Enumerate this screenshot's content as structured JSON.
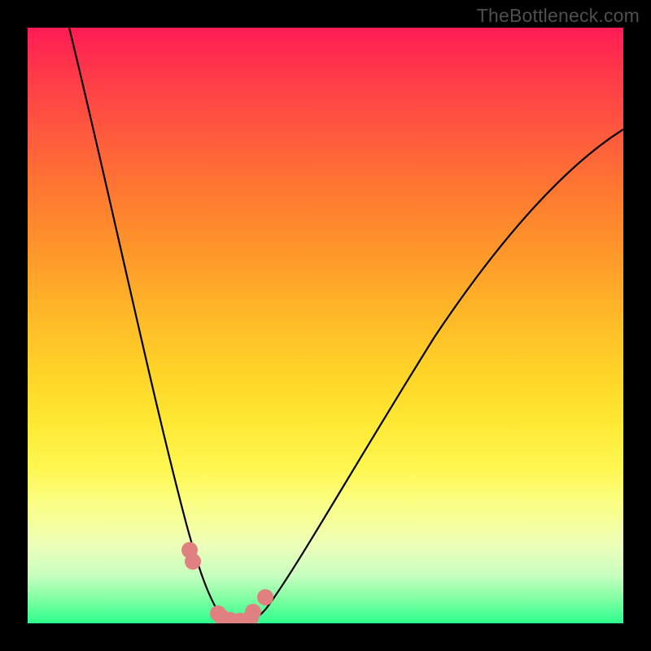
{
  "watermark": "TheBottleneck.com",
  "colors": {
    "background": "#000000",
    "curve": "#000000",
    "marker_fill": "#e18080",
    "marker_stroke": "#c96f6f"
  },
  "chart_data": {
    "type": "line",
    "title": "",
    "xlabel": "",
    "ylabel": "",
    "xlim": [
      0,
      100
    ],
    "ylim": [
      0,
      100
    ],
    "note": "Axis values estimated from pixel positions (no tick labels visible). y is inverted: 0 at bottom, 100 at top.",
    "series": [
      {
        "name": "left-curve",
        "x": [
          7,
          10,
          13,
          16,
          18,
          20,
          22,
          24,
          25.5,
          27,
          28.5,
          30,
          31.5,
          33
        ],
        "y": [
          100,
          86,
          72,
          58,
          48,
          40,
          32,
          24,
          18,
          12.5,
          8,
          4.5,
          2,
          0.5
        ]
      },
      {
        "name": "right-curve",
        "x": [
          37,
          39,
          42,
          46,
          50,
          55,
          60,
          66,
          72,
          79,
          86,
          93,
          100
        ],
        "y": [
          0.5,
          3,
          7,
          13,
          20,
          28,
          36,
          45,
          53,
          61,
          69,
          76,
          83
        ]
      },
      {
        "name": "valley-floor",
        "x": [
          33,
          34,
          35,
          36,
          37
        ],
        "y": [
          0.5,
          0.2,
          0.2,
          0.2,
          0.5
        ]
      }
    ],
    "markers": [
      {
        "x": 27.2,
        "y": 12.3
      },
      {
        "x": 27.7,
        "y": 10.4
      },
      {
        "x": 31.9,
        "y": 1.6
      },
      {
        "x": 32.7,
        "y": 0.9
      },
      {
        "x": 34.0,
        "y": 0.5
      },
      {
        "x": 35.6,
        "y": 0.4
      },
      {
        "x": 37.4,
        "y": 0.9
      },
      {
        "x": 37.9,
        "y": 1.9
      },
      {
        "x": 39.9,
        "y": 4.4
      }
    ]
  }
}
